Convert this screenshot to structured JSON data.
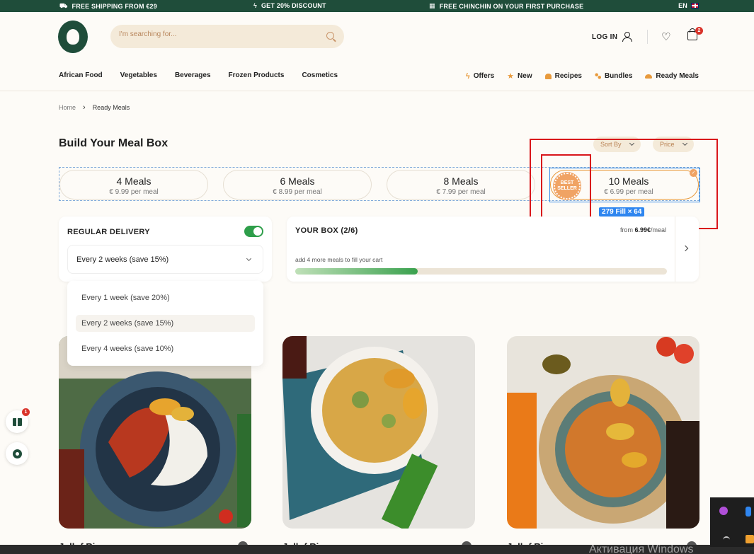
{
  "topbar": {
    "shipping": "FREE SHIPPING FROM €29",
    "discount": "GET 20% DISCOUNT",
    "chinchin": "FREE CHINCHIN ON YOUR FIRST PURCHASE",
    "lang": "EN"
  },
  "header": {
    "search_placeholder": "I'm searching for...",
    "login": "LOG IN",
    "cart_count": "2"
  },
  "nav": {
    "left": [
      "African Food",
      "Vegetables",
      "Beverages",
      "Frozen Products",
      "Cosmetics"
    ],
    "right": [
      "Offers",
      "New",
      "Recipes",
      "Bundles",
      "Ready Meals"
    ]
  },
  "breadcrumb": {
    "home": "Home",
    "current": "Ready Meals"
  },
  "page": {
    "title": "Build Your Meal Box",
    "sort_by": "Sort By",
    "price": "Price"
  },
  "meal_options": [
    {
      "title": "4 Meals",
      "price": "€ 9.99 per meal"
    },
    {
      "title": "6 Meals",
      "price": "€ 8.99 per meal"
    },
    {
      "title": "8 Meals",
      "price": "€ 7.99 per meal"
    },
    {
      "title": "10 Meals",
      "price": "€ 6.99 per meal",
      "selected": true
    }
  ],
  "badge": {
    "line1": "BEST",
    "line2": "SELLER",
    "size_label": "279 Fill × 64"
  },
  "delivery": {
    "label": "REGULAR DELIVERY",
    "selected": "Every 2 weeks (save 15%)",
    "options": [
      "Every 1 week (save 20%)",
      "Every 2 weeks (save 15%)",
      "Every 4 weeks (save 10%)"
    ]
  },
  "box": {
    "title": "YOUR BOX (2/6)",
    "from_prefix": "from ",
    "from_price": "6.99€",
    "from_suffix": "/meal",
    "hint": "add 4 more meals to fill your cart",
    "progress": 0.33
  },
  "products": [
    {
      "title": "Jollof Ri"
    },
    {
      "title": "Jollof Ri"
    },
    {
      "title": "Jollof Ri"
    }
  ],
  "floating": {
    "gift_count": "1"
  },
  "os": {
    "watermark": "Активация Windows"
  },
  "colors": {
    "brand_green": "#1f4d3a",
    "accent_orange": "#e89a3c",
    "toggle_green": "#2e9e4a",
    "annotation_red": "#d9161b",
    "selection_blue": "#3b8fe8"
  }
}
